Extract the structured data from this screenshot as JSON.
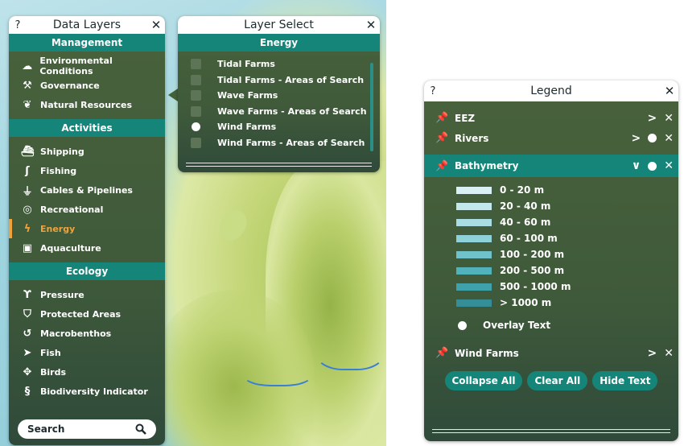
{
  "data_layers": {
    "title": "Data Layers",
    "help": "?",
    "close": "✕",
    "sections": [
      {
        "label": "Management",
        "items": [
          {
            "label": "Environmental Conditions",
            "icon": "cloud-icon"
          },
          {
            "label": "Governance",
            "icon": "gavel-icon"
          },
          {
            "label": "Natural Resources",
            "icon": "leaf-icon"
          }
        ]
      },
      {
        "label": "Activities",
        "items": [
          {
            "label": "Shipping",
            "icon": "ship-icon"
          },
          {
            "label": "Fishing",
            "icon": "hook-icon"
          },
          {
            "label": "Cables & Pipelines",
            "icon": "pipeline-icon"
          },
          {
            "label": "Recreational",
            "icon": "snorkel-icon"
          },
          {
            "label": "Energy",
            "icon": "lightning-icon",
            "active": true
          },
          {
            "label": "Aquaculture",
            "icon": "cage-icon"
          }
        ]
      },
      {
        "label": "Ecology",
        "items": [
          {
            "label": "Pressure",
            "icon": "pressure-icon"
          },
          {
            "label": "Protected Areas",
            "icon": "shield-icon"
          },
          {
            "label": "Macrobenthos",
            "icon": "shell-icon"
          },
          {
            "label": "Fish",
            "icon": "fish-icon"
          },
          {
            "label": "Birds",
            "icon": "bird-icon"
          },
          {
            "label": "Biodiversity Indicator",
            "icon": "dna-icon"
          }
        ]
      }
    ],
    "search_placeholder": "Search"
  },
  "layer_select": {
    "title": "Layer Select",
    "close": "✕",
    "section": "Energy",
    "items": [
      {
        "label": "Tidal Farms",
        "selected": false
      },
      {
        "label": "Tidal Farms - Areas of Search",
        "selected": false
      },
      {
        "label": "Wave Farms",
        "selected": false
      },
      {
        "label": "Wave Farms - Areas of Search",
        "selected": false
      },
      {
        "label": "Wind Farms",
        "selected": true
      },
      {
        "label": "Wind Farms - Areas of Search",
        "selected": false
      }
    ]
  },
  "legend": {
    "title": "Legend",
    "help": "?",
    "close": "✕",
    "rows": {
      "eez": {
        "label": "EEZ",
        "pinned": false
      },
      "rivers": {
        "label": "Rivers",
        "pinned": true
      },
      "bathymetry": {
        "label": "Bathymetry",
        "pinned": true
      },
      "wind_farms": {
        "label": "Wind Farms",
        "pinned": false
      }
    },
    "ramp": [
      {
        "label": "0 - 20 m",
        "color": "#d9f1f4"
      },
      {
        "label": "20 - 40 m",
        "color": "#c2e8ec"
      },
      {
        "label": "40 - 60 m",
        "color": "#a9dde3"
      },
      {
        "label": "60 - 100 m",
        "color": "#8ed1d8"
      },
      {
        "label": "100 - 200 m",
        "color": "#6fc2ca"
      },
      {
        "label": "200 - 500 m",
        "color": "#52b2bb"
      },
      {
        "label": "500 - 1000 m",
        "color": "#3fa1ab"
      },
      {
        "label": "> 1000 m",
        "color": "#348d97"
      }
    ],
    "overlay_text": "Overlay Text",
    "buttons": {
      "collapse": "Collapse All",
      "clear": "Clear All",
      "hide": "Hide Text"
    }
  },
  "colors": {
    "teal": "#168579",
    "active": "#f0a23a",
    "panel": "#43603c"
  }
}
